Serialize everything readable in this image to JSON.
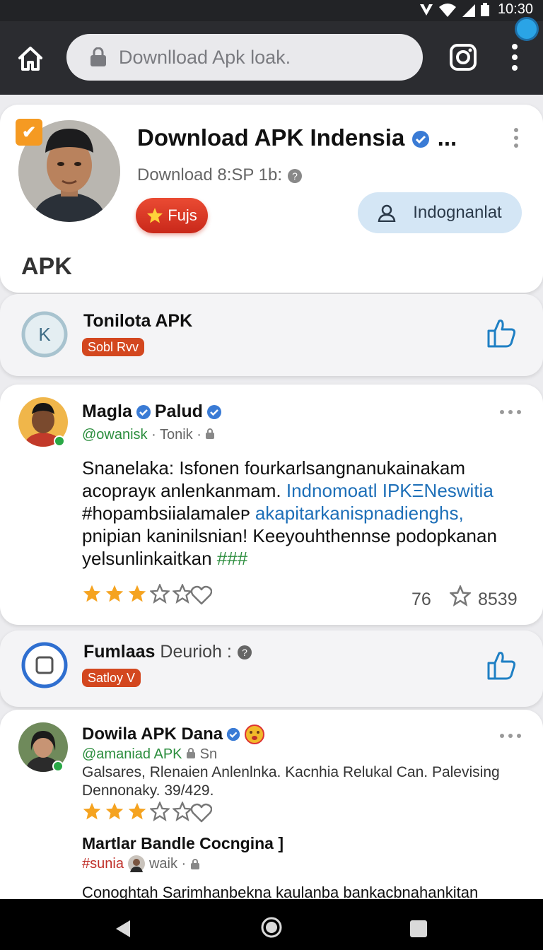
{
  "status_bar": {
    "time": "10:30"
  },
  "browser": {
    "url_text": "Downlload Apk loak."
  },
  "profile": {
    "title": "Download APK Indensia",
    "title_suffix": "...",
    "subtitle": "Download  8:SP  1b:",
    "fujs_label": "Fujs",
    "follow_label": "Indognanlat",
    "apk_label": "APK"
  },
  "card1": {
    "title": "Tonilota APK",
    "tag": "Sobl Rvv"
  },
  "post1": {
    "name_first": "Magla",
    "name_last": "Palud",
    "handle": "@owanisk",
    "meta": "·  Tonik ·",
    "body_line1": "Snanelaka: Isfonen fourkarlsangnanukainakam",
    "body_line2_plain": "acopraук anlenkanmam.",
    "body_line2_link": "Indnomoatl IPKΞNeswitia",
    "body_line3_plain": "#hopambsiialamaleᴘ",
    "body_line3_link": "akapitarkanispnadienghs,",
    "body_line4": "pnipian kaninilsnian! Keeyouhthennse podopkanan",
    "body_line5_plain": "yelsunlinkaitkan",
    "body_line5_hash": "###",
    "rating": 3,
    "rating_max": 5,
    "stat_count": "76",
    "star_count": "8539"
  },
  "card2": {
    "title_bold": "Fumlaas",
    "title_rest": "Deurioh :",
    "tag": "Satloy V"
  },
  "post2": {
    "name": "Dowila APK Dana",
    "handle": "@amaniad APK",
    "handle_rest": "Sn",
    "body": "Galsares, Rlenaien Anlenlnka. Kacnhia  Relukal Can. Palevising Dennonaky. 39/429.",
    "rating": 3,
    "rating_max": 5,
    "sub_title": "Martlar Bandle Cocngina ]",
    "sub_hash": "#sunia",
    "sub_meta": "waik ·",
    "footer": "Conoghtah Sarimhanbekna kaulanba bankacbnahankitan"
  },
  "colors": {
    "accent_blue": "#1d6fb8",
    "star_orange": "#f5a320",
    "tag_red": "#d3471f",
    "follow_bg": "#d4e6f5"
  }
}
